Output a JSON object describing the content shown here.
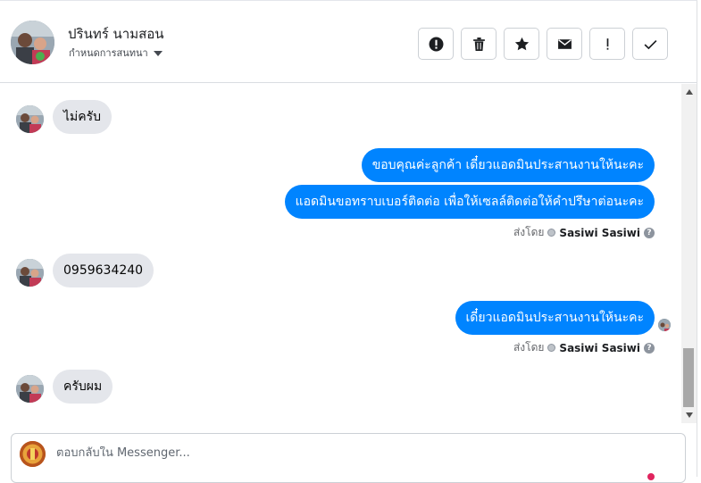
{
  "header": {
    "contact_name": "ปรินทร์ นามสอน",
    "settings_label": "กำหนดการสนทนา"
  },
  "actions": [
    {
      "icon": "alert-circle-icon"
    },
    {
      "icon": "trash-icon"
    },
    {
      "icon": "star-icon"
    },
    {
      "icon": "envelope-icon"
    },
    {
      "icon": "exclamation-icon"
    },
    {
      "icon": "check-icon"
    }
  ],
  "messages": [
    {
      "direction": "incoming",
      "text": "ไม่ครับ"
    },
    {
      "direction": "outgoing",
      "text": "ขอบคุณค่ะลูกค้า เดี๋ยวแอดมินประสานงานให้นะคะ"
    },
    {
      "direction": "outgoing",
      "text": "แอดมินขอทราบเบอร์ติดต่อ เพื่อให้เซลล์ติดต่อให้คำปรึษาต่อนะคะ"
    },
    {
      "direction": "incoming",
      "text": "0959634240"
    },
    {
      "direction": "outgoing",
      "text": "เดี๋ยวแอดมินประสานงานให้นะคะ"
    },
    {
      "direction": "incoming",
      "text": "ครับผม"
    }
  ],
  "sent_by": [
    {
      "prefix": "ส่งโดย",
      "name": "Sasiwi Sasiwi",
      "help": "?"
    },
    {
      "prefix": "ส่งโดย",
      "name": "Sasiwi Sasiwi",
      "help": "?"
    }
  ],
  "composer": {
    "placeholder": "ตอบกลับใน Messenger..."
  },
  "colors": {
    "outgoing_bubble": "#0084ff",
    "incoming_bubble": "#e4e6eb"
  }
}
